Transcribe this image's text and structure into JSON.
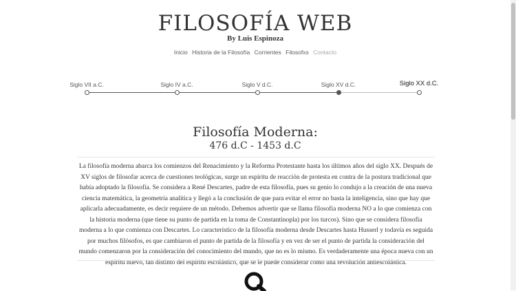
{
  "header": {
    "title": "FILOSOFÍA WEB",
    "byline": "By Luis Espinoza"
  },
  "nav": {
    "items": [
      {
        "label": "Inicio"
      },
      {
        "label": "Historia de la Filosofía"
      },
      {
        "label": "Corrientes"
      },
      {
        "label": "Filosofxs"
      },
      {
        "label": "Contacto"
      }
    ]
  },
  "timeline": {
    "points": [
      {
        "label": "Siglo VII a.C."
      },
      {
        "label": "Siglo IV a.C."
      },
      {
        "label": "Siglo V d.C."
      },
      {
        "label": "Siglo XV d.C."
      },
      {
        "label": "Siglo XX d.C."
      }
    ]
  },
  "section": {
    "title": "Filosofía Moderna:",
    "dates": "476 d.C - 1453 d.C",
    "body": "La filosofía moderna abarca los comienzos del Renacimiento y la Reforma Protestante hasta los últimos años del siglo XX. Después de XV siglos de filosofar acerca de cuestiones teológicas, surge un espíritu de reacción de protesta en contra de la postura tradicional que había adoptado la filosofía. Se considera a René Descartes, padre de esta filosofía, pues su genio lo condujo a la creación de una nueva ciencia matemática, la geometría analítica y llegó a la conclusión de que para evitar el error no basta la inteligencia, sino que hay que aplicarla adecuadamente, es decir requiere de un método. Debemos advertir que se llama filosofía moderna NO a lo que comienza con la historia moderna (que tiene su punto de partida en la toma de Constantinopla) por los turcos). Sino que se considera filosofía moderna a lo que comienza con Descartes. Lo característico de la filosofía moderna desde Descartes hasta Husserl y todavía es seguida por muchos filósofos, es que cambiaron el punto de partida de la filosofía y en vez de ser el punto de partida la consideración del mundo comenzaron por la consideración del conocimiento del mundo, que no es lo mismo. Es verdaderamente una época nueva con un espíritu nuevo, tan distinto del espíritu escolástico, que se le puede considerar como una revolución antiescolástica."
  },
  "icons": {
    "search": "search-icon"
  },
  "colors": {
    "text": "#333333",
    "nav_link": "#5a5a5a",
    "nav_muted": "#a8a8a8",
    "timeline": "#555555"
  }
}
